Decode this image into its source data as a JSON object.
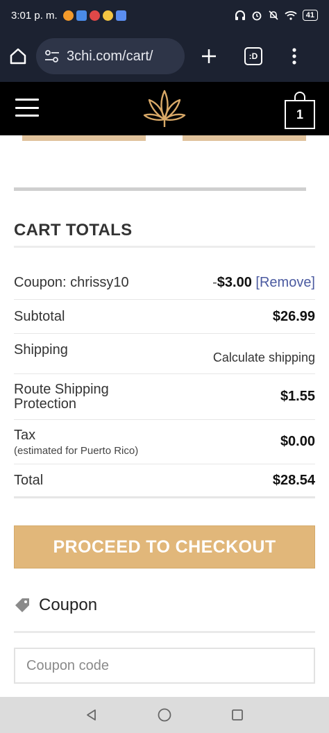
{
  "status_bar": {
    "time": "3:01 p. m.",
    "battery": "41",
    "colors": {
      "background": "#1c2231"
    }
  },
  "browser": {
    "url": "3chi.com/cart/",
    "icons": [
      "home-icon",
      "site-settings-icon",
      "new-tab-icon",
      "tab-switcher-icon",
      "more-menu-icon"
    ],
    "tab_label": ":D"
  },
  "site_header": {
    "cart_count": "1",
    "icons": [
      "hamburger-menu-icon",
      "cannabis-leaf-logo",
      "shopping-bag-icon"
    ]
  },
  "cart_totals": {
    "title": "CART TOTALS",
    "coupon": {
      "label": "Coupon: chrissy10",
      "prefix": "-",
      "amount": "$3.00",
      "remove": "[Remove]"
    },
    "subtotal": {
      "label": "Subtotal",
      "value": "$26.99"
    },
    "shipping": {
      "label": "Shipping",
      "value": "Calculate shipping"
    },
    "route": {
      "label_line1": "Route Shipping",
      "label_line2": "Protection",
      "value": "$1.55"
    },
    "tax": {
      "label": "Tax",
      "note": "(estimated for Puerto Rico)",
      "value": "$0.00"
    },
    "total": {
      "label": "Total",
      "value": "$28.54"
    }
  },
  "checkout_button": {
    "label": "PROCEED TO CHECKOUT",
    "color": "#e1b77a"
  },
  "coupon_section": {
    "heading": "Coupon",
    "input_placeholder": "Coupon code",
    "icon": "tag-icon"
  },
  "nav_bar": {
    "icons": [
      "back-icon",
      "home-icon",
      "recents-icon"
    ]
  }
}
